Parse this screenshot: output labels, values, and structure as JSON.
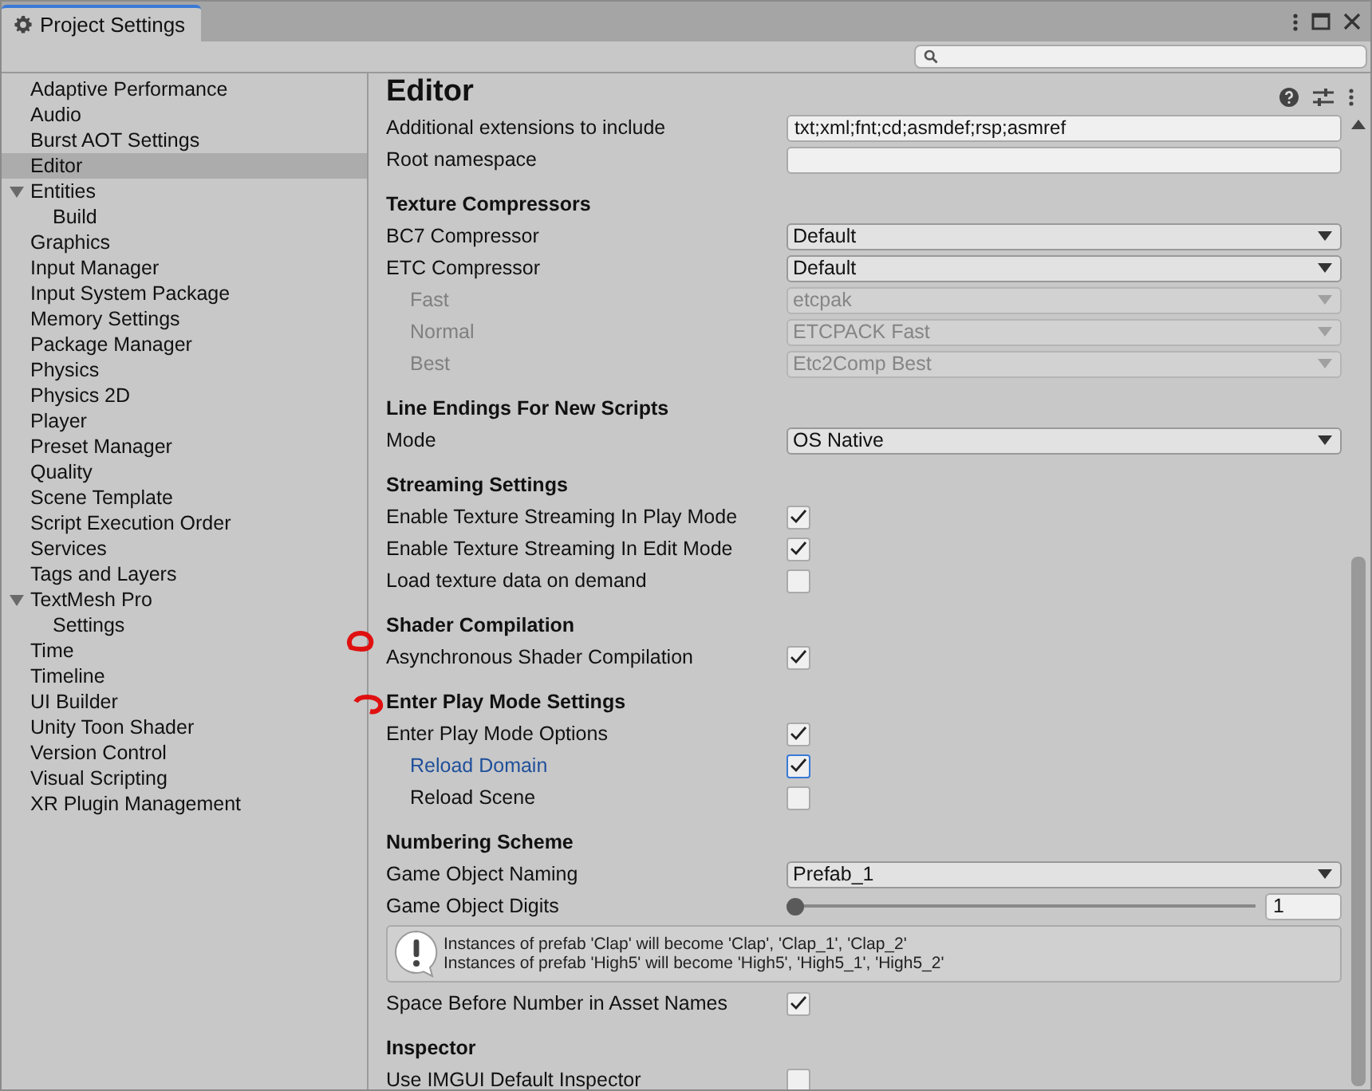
{
  "window": {
    "tab_title": "Project Settings"
  },
  "sidebar": {
    "items": [
      {
        "label": "Adaptive Performance",
        "selected": false
      },
      {
        "label": "Audio",
        "selected": false
      },
      {
        "label": "Burst AOT Settings",
        "selected": false
      },
      {
        "label": "Editor",
        "selected": true
      },
      {
        "label": "Entities",
        "selected": false,
        "expanded": true,
        "children": [
          {
            "label": "Build",
            "selected": false
          }
        ]
      },
      {
        "label": "Graphics",
        "selected": false
      },
      {
        "label": "Input Manager",
        "selected": false
      },
      {
        "label": "Input System Package",
        "selected": false
      },
      {
        "label": "Memory Settings",
        "selected": false
      },
      {
        "label": "Package Manager",
        "selected": false
      },
      {
        "label": "Physics",
        "selected": false
      },
      {
        "label": "Physics 2D",
        "selected": false
      },
      {
        "label": "Player",
        "selected": false
      },
      {
        "label": "Preset Manager",
        "selected": false
      },
      {
        "label": "Quality",
        "selected": false
      },
      {
        "label": "Scene Template",
        "selected": false
      },
      {
        "label": "Script Execution Order",
        "selected": false
      },
      {
        "label": "Services",
        "selected": false
      },
      {
        "label": "Tags and Layers",
        "selected": false
      },
      {
        "label": "TextMesh Pro",
        "selected": false,
        "expanded": true,
        "children": [
          {
            "label": "Settings",
            "selected": false
          }
        ]
      },
      {
        "label": "Time",
        "selected": false
      },
      {
        "label": "Timeline",
        "selected": false
      },
      {
        "label": "UI Builder",
        "selected": false
      },
      {
        "label": "Unity Toon Shader",
        "selected": false
      },
      {
        "label": "Version Control",
        "selected": false
      },
      {
        "label": "Visual Scripting",
        "selected": false
      },
      {
        "label": "XR Plugin Management",
        "selected": false
      }
    ]
  },
  "panel": {
    "title": "Editor",
    "rows": [
      {
        "kind": "field",
        "label": "Additional extensions to include",
        "value": "txt;xml;fnt;cd;asmdef;rsp;asmref"
      },
      {
        "kind": "field",
        "label": "Root namespace"
      },
      {
        "kind": "header",
        "label": "Texture Compressors"
      },
      {
        "kind": "dropdown",
        "label": "BC7 Compressor",
        "value": "Default",
        "disabled": false
      },
      {
        "kind": "dropdown",
        "label": "ETC Compressor",
        "value": "Default",
        "disabled": false,
        "children": [
          {
            "kind": "dropdown",
            "label": "Fast",
            "value": "etcpak",
            "disabled": true
          },
          {
            "kind": "dropdown",
            "label": "Normal",
            "value": "ETCPACK Fast",
            "disabled": true
          },
          {
            "kind": "dropdown",
            "label": "Best",
            "value": "Etc2Comp Best",
            "disabled": true
          }
        ]
      },
      {
        "kind": "header",
        "label": "Line Endings For New Scripts"
      },
      {
        "kind": "dropdown",
        "label": "Mode",
        "value": "OS Native",
        "disabled": false
      },
      {
        "kind": "header",
        "label": "Streaming Settings"
      },
      {
        "kind": "checkbox",
        "label": "Enable Texture Streaming In Play Mode",
        "checked": true,
        "focused": false
      },
      {
        "kind": "checkbox",
        "label": "Enable Texture Streaming In Edit Mode",
        "checked": true,
        "focused": false
      },
      {
        "kind": "checkbox",
        "label": "Load texture data on demand",
        "checked": false,
        "focused": false
      },
      {
        "kind": "header",
        "label": "Shader Compilation"
      },
      {
        "kind": "checkbox",
        "label": "Asynchronous Shader Compilation",
        "checked": true,
        "focused": false
      },
      {
        "kind": "header",
        "label": "Enter Play Mode Settings"
      },
      {
        "kind": "checkbox",
        "label": "Enter Play Mode Options",
        "checked": true,
        "focused": false,
        "children": [
          {
            "kind": "checkbox",
            "label": "Reload Domain",
            "checked": true,
            "focused": true
          },
          {
            "kind": "checkbox",
            "label": "Reload Scene",
            "checked": false,
            "focused": false
          }
        ]
      },
      {
        "kind": "header",
        "label": "Numbering Scheme"
      },
      {
        "kind": "dropdown",
        "label": "Game Object Naming",
        "value": "Prefab_1",
        "disabled": false
      },
      {
        "kind": "slider",
        "label": "Game Object Digits",
        "value": "1",
        "level": 0
      },
      {
        "kind": "helpbox",
        "lines": [
          "Instances of prefab 'Clap' will become 'Clap', 'Clap_1', 'Clap_2'",
          "Instances of prefab 'High5' will become 'High5', 'High5_1', 'High5_2'"
        ]
      },
      {
        "kind": "checkbox",
        "label": "Space Before Number in Asset Names",
        "checked": true,
        "focused": false
      },
      {
        "kind": "header",
        "label": "Inspector"
      },
      {
        "kind": "checkbox",
        "label": "Use IMGUI Default Inspector",
        "checked": false,
        "focused": false
      }
    ]
  }
}
